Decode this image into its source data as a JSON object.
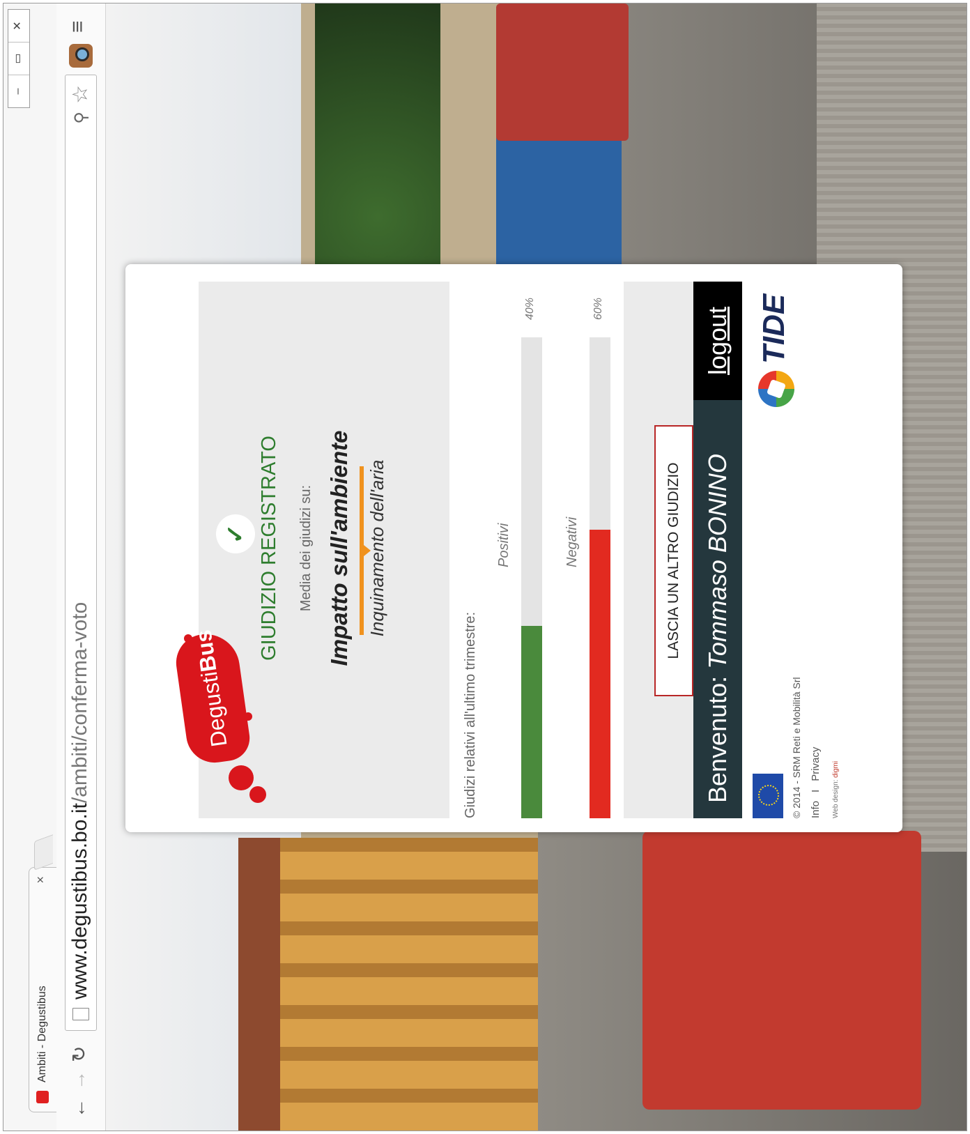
{
  "browser": {
    "tab_title": "Ambiti - Degustibus",
    "tab_close": "×",
    "url_host": "www.degustibus.bo.it",
    "url_path": "/ambiti/conferma-voto",
    "win_controls": [
      "‒",
      "▭",
      "✕"
    ]
  },
  "page": {
    "logo_text_light": "Degusti",
    "logo_text_bold": "Bus",
    "status_title": "GIUDIZIO REGISTRATO",
    "media_label": "Media dei giudizi su:",
    "category": "Impatto sull'ambiente",
    "subcategory": "Inquinamento dell'aria",
    "stats_label": "Giudizi relativi all'ultimo trimestre:",
    "bars": [
      {
        "name": "Positivi",
        "percent": 40,
        "percent_label": "40%",
        "color": "#4a8a3c"
      },
      {
        "name": "Negativi",
        "percent": 60,
        "percent_label": "60%",
        "color": "#e22a20"
      }
    ],
    "action_button": "LASCIA UN ALTRO GIUDIZIO",
    "welcome_prefix": "Benvenuto:",
    "welcome_name": "Tommaso BONINO",
    "logout": "logout",
    "copyright": "© 2014 - SRM Reti e Mobilità Srl",
    "link_info": "Info",
    "link_sep": "I",
    "link_privacy": "Privacy",
    "webdesign_label": "Web design:",
    "webdesign_name": "digmi",
    "partner_logo": "TIDE"
  },
  "colors": {
    "accent_green": "#2e7d2e",
    "accent_red": "#d9161c",
    "accent_orange": "#f0921e",
    "welcome_bar": "#24373d"
  }
}
